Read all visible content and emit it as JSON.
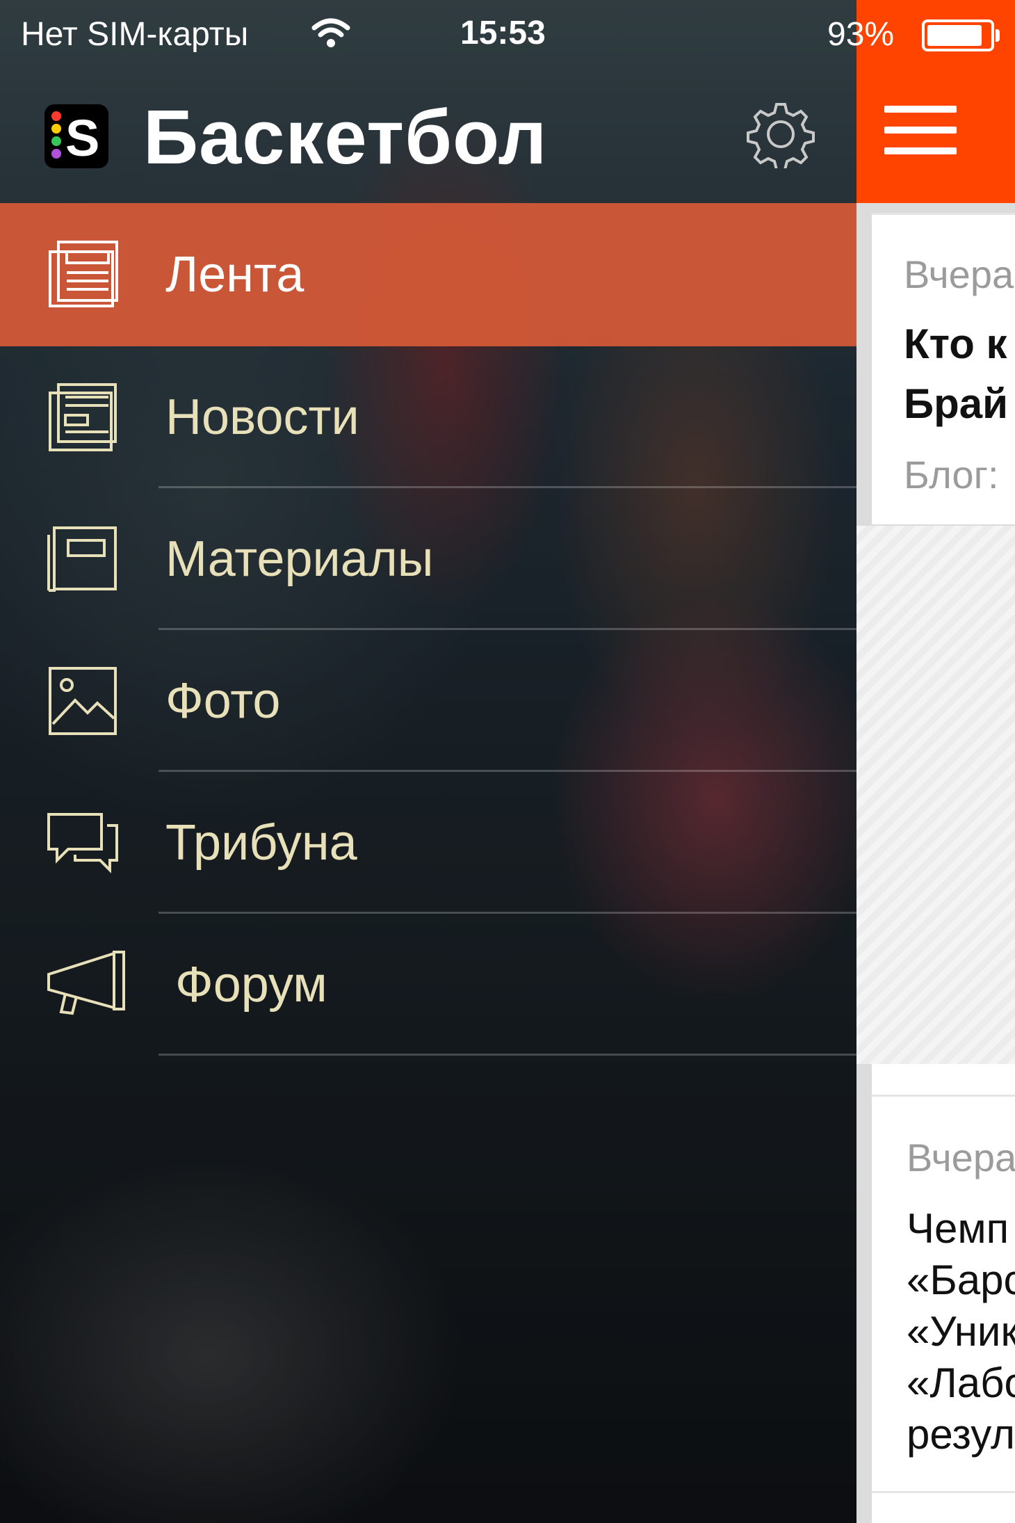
{
  "status_bar": {
    "carrier": "Нет SIM-карты",
    "time": "15:53",
    "battery": "93%"
  },
  "header": {
    "title": "Баскетбол",
    "logo_letter": "S",
    "settings_icon": "gear-icon"
  },
  "menu": {
    "items": [
      {
        "label": "Лента",
        "icon": "feed-icon",
        "active": true
      },
      {
        "label": "Новости",
        "icon": "news-icon",
        "active": false
      },
      {
        "label": "Материалы",
        "icon": "articles-icon",
        "active": false
      },
      {
        "label": "Фото",
        "icon": "photo-icon",
        "active": false
      },
      {
        "label": "Трибуна",
        "icon": "chat-bubbles-icon",
        "active": false
      },
      {
        "label": "Форум",
        "icon": "megaphone-icon",
        "active": false
      }
    ]
  },
  "content": {
    "menu_icon": "hamburger-icon",
    "card1": {
      "date": "Вчера",
      "headline_line1": "Кто к",
      "headline_line2": "Брай",
      "category": "Блог:"
    },
    "card2": {
      "date": "Вчера",
      "lines": [
        "Чемп",
        "«Барс",
        "«Уник",
        "«Лабо",
        "резул"
      ]
    }
  },
  "colors": {
    "accent": "#ff4400",
    "active_item": "#d75a37",
    "menu_text": "#e8e0b8"
  }
}
